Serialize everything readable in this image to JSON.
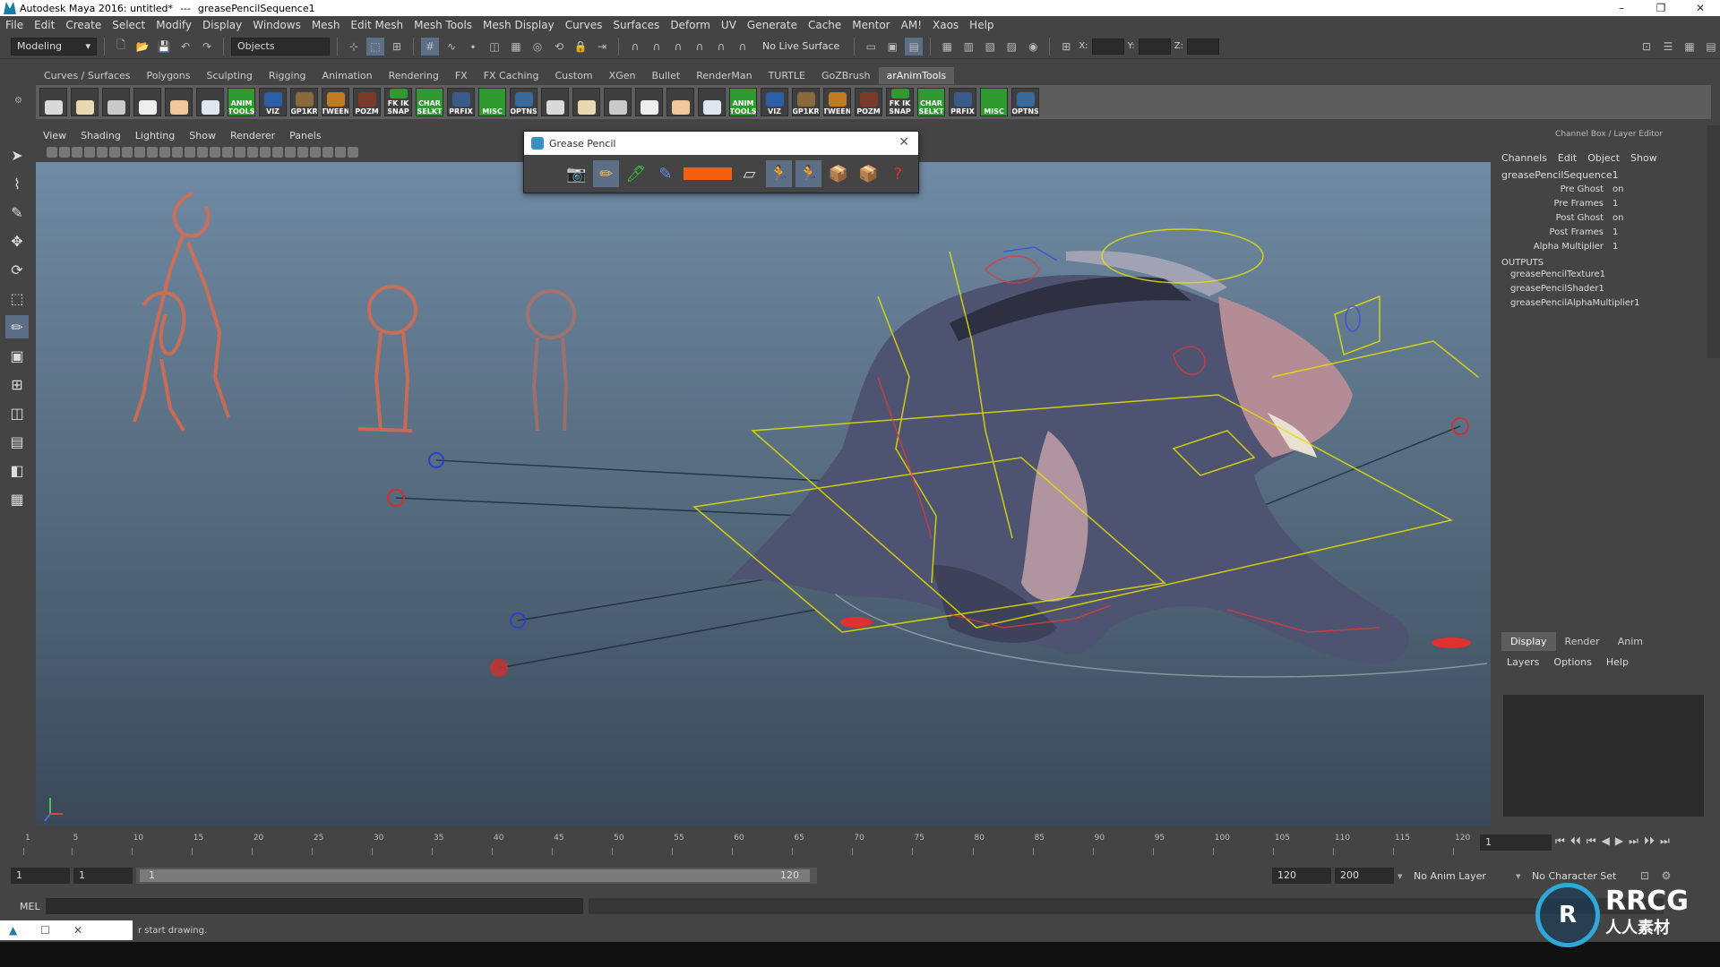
{
  "window": {
    "app_title": "Autodesk Maya 2016: untitled*",
    "separator": "---",
    "doc_title": "greasePencilSequence1",
    "controls": [
      "–",
      "❐",
      "✕"
    ]
  },
  "menus": [
    "File",
    "Edit",
    "Create",
    "Select",
    "Modify",
    "Display",
    "Windows",
    "Mesh",
    "Edit Mesh",
    "Mesh Tools",
    "Mesh Display",
    "Curves",
    "Surfaces",
    "Deform",
    "UV",
    "Generate",
    "Cache",
    "Mentor",
    "AM!",
    "Xaos",
    "Help"
  ],
  "status_line": {
    "mode": "Modeling",
    "selection": "Objects",
    "live_surface": "No Live Surface",
    "x_label": "X:",
    "y_label": "Y:",
    "z_label": "Z:"
  },
  "shelf": {
    "tabs": [
      "Curves / Surfaces",
      "Polygons",
      "Sculpting",
      "Rigging",
      "Animation",
      "Rendering",
      "FX",
      "FX Caching",
      "Custom",
      "XGen",
      "Bullet",
      "RenderMan",
      "TURTLE",
      "GoZBrush",
      "arAnimTools"
    ],
    "active_tab": "arAnimTools",
    "labeled_buttons": [
      {
        "label": "ANIM TOOLS",
        "color": "#2f9a2f"
      },
      {
        "label": "VIZ",
        "color": "#2a5fa8"
      },
      {
        "label": "GP1KR",
        "color": "#8a6a3a"
      },
      {
        "label": "TWEEN",
        "color": "#c07a20"
      },
      {
        "label": "POZM",
        "color": "#7a3a2a"
      },
      {
        "label": "FK IK SNAP",
        "color": "#2f9a2f"
      },
      {
        "label": "CHAR SELKT",
        "color": "#2f9a2f"
      },
      {
        "label": "PRFIX",
        "color": "#3a5a8a"
      },
      {
        "label": "MISC",
        "color": "#2f9a2f"
      },
      {
        "label": "OPTNS",
        "color": "#3a6a9a"
      }
    ]
  },
  "viewport": {
    "menu": [
      "View",
      "Shading",
      "Lighting",
      "Show",
      "Renderer",
      "Panels"
    ]
  },
  "grease_pencil": {
    "title": "Grease Pencil",
    "brush_color": "#f25f0e",
    "tools": [
      "camera-icon",
      "pencil-icon",
      "marker-icon",
      "soft-pencil-icon",
      "color-swatch",
      "eraser-icon",
      "ghost-prev-icon",
      "ghost-next-icon",
      "import-frame-icon",
      "export-frame-icon",
      "help-icon"
    ]
  },
  "channel_box": {
    "header": "Channel Box / Layer Editor",
    "menu": [
      "Channels",
      "Edit",
      "Object",
      "Show"
    ],
    "object": "greasePencilSequence1",
    "attributes": [
      {
        "name": "Pre Ghost",
        "value": "on"
      },
      {
        "name": "Pre Frames",
        "value": "1"
      },
      {
        "name": "Post Ghost",
        "value": "on"
      },
      {
        "name": "Post Frames",
        "value": "1"
      },
      {
        "name": "Alpha Multiplier",
        "value": "1"
      }
    ],
    "outputs_label": "OUTPUTS",
    "outputs": [
      "greasePencilTexture1",
      "greasePencilShader1",
      "greasePencilAlphaMultiplier1"
    ]
  },
  "layer_editor": {
    "tabs": [
      "Display",
      "Render",
      "Anim"
    ],
    "active_tab": "Display",
    "menu": [
      "Layers",
      "Options",
      "Help"
    ]
  },
  "timeline": {
    "ticks": [
      "1",
      "5",
      "10",
      "15",
      "20",
      "25",
      "30",
      "35",
      "40",
      "45",
      "50",
      "55",
      "60",
      "65",
      "70",
      "75",
      "80",
      "85",
      "90",
      "95",
      "100",
      "105",
      "110",
      "115",
      "120"
    ],
    "current_frame": "1",
    "playback_buttons": [
      "⏮",
      "⏴⏴",
      "⏮",
      "◀",
      "▶",
      "⏭",
      "⏵⏵",
      "⏭"
    ]
  },
  "range_slider": {
    "start": "1",
    "playback_start": "1",
    "slider_start": "1",
    "slider_end": "120",
    "playback_end": "120",
    "end": "200",
    "anim_layer": "No Anim Layer",
    "character_set": "No Character Set"
  },
  "command_line": {
    "label": "MEL"
  },
  "help_line": {
    "message": "r start drawing."
  },
  "watermark": {
    "logo_text": "RRCG",
    "logo_subtext": "人人素材"
  }
}
